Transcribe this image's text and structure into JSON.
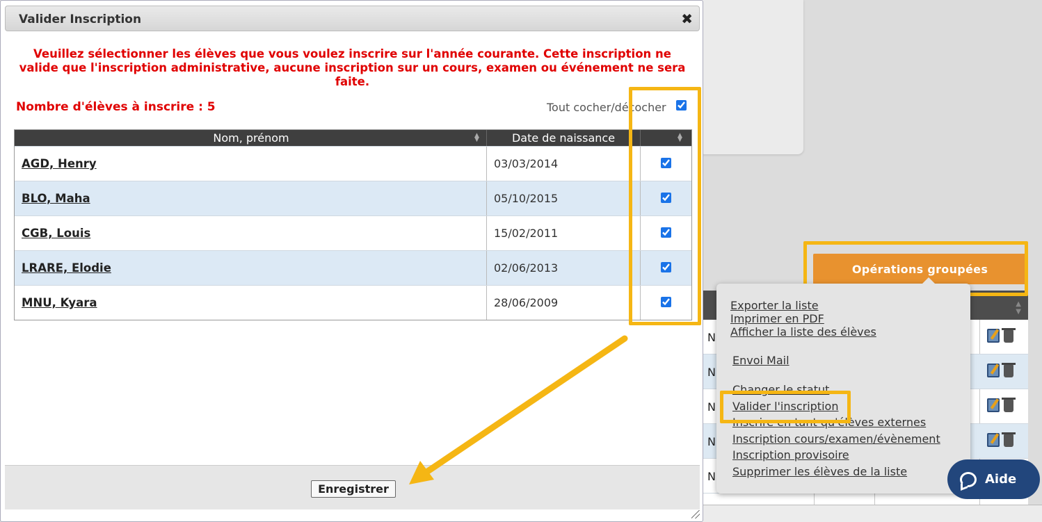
{
  "modal": {
    "title": "Valider Inscription",
    "notice": "Veuillez sélectionner les élèves que vous voulez inscrire sur l'année courante. Cette inscription ne valide que l'inscription administrative, aucune inscription sur un cours, examen ou événement ne sera faite.",
    "count_label": "Nombre d'élèves à inscrire : 5",
    "toggle_all_label": "Tout cocher/décocher",
    "columns": [
      "Nom, prénom",
      "Date de naissance"
    ],
    "rows": [
      {
        "name": "AGD, Henry",
        "dob": "03/03/2014",
        "checked": true
      },
      {
        "name": "BLO, Maha",
        "dob": "05/10/2015",
        "checked": true
      },
      {
        "name": "CGB, Louis",
        "dob": "15/02/2011",
        "checked": true
      },
      {
        "name": "LRARE, Elodie",
        "dob": "02/06/2013",
        "checked": true
      },
      {
        "name": "MNU, Kyara",
        "dob": "28/06/2009",
        "checked": true
      }
    ],
    "save_label": "Enregistrer"
  },
  "operations_button": "Opérations groupées",
  "menu": {
    "items": [
      "Exporter la liste",
      "Imprimer en PDF",
      "Afficher la liste des élèves",
      "Envoi Mail",
      "Changer le statut",
      "Valider l'inscription",
      "Inscrire en tant qu'élèves externes",
      "Inscription cours/examen/évènement",
      "Inscription provisoire",
      "Supprimer les élèves de la liste"
    ]
  },
  "background_rows": [
    "N",
    "N",
    "N",
    "N",
    "N"
  ],
  "help_button": "Aide",
  "colors": {
    "accent_orange": "#e8922f",
    "highlight": "#f5b614",
    "alert_red": "#e00000",
    "help_blue": "#22467c"
  }
}
